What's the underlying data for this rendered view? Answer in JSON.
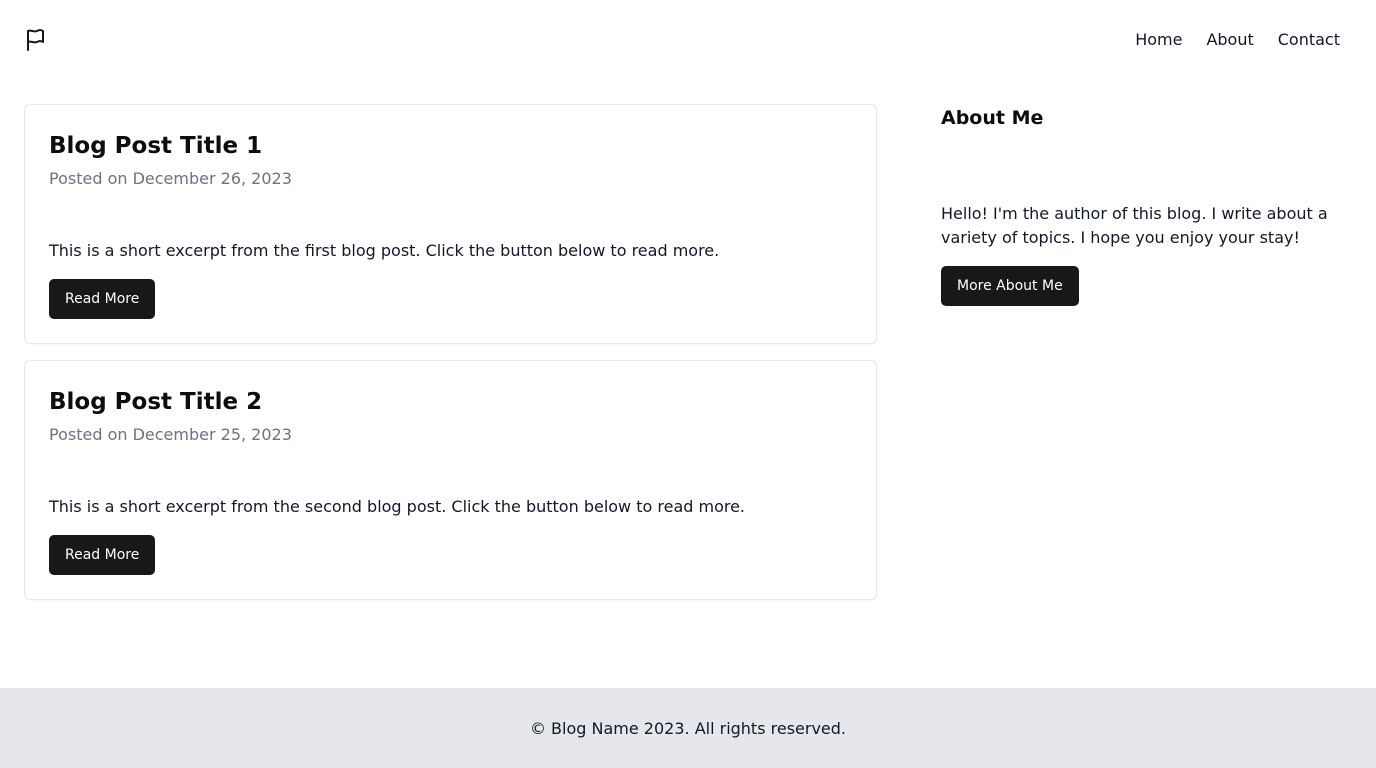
{
  "header": {
    "logo_icon": "flag-icon",
    "nav": [
      {
        "label": "Home"
      },
      {
        "label": "About"
      },
      {
        "label": "Contact"
      }
    ]
  },
  "posts": [
    {
      "title": "Blog Post Title 1",
      "date": "Posted on December 26, 2023",
      "excerpt": "This is a short excerpt from the first blog post. Click the button below to read more.",
      "button": "Read More"
    },
    {
      "title": "Blog Post Title 2",
      "date": "Posted on December 25, 2023",
      "excerpt": "This is a short excerpt from the second blog post. Click the button below to read more.",
      "button": "Read More"
    }
  ],
  "sidebar": {
    "title": "About Me",
    "text": "Hello! I'm the author of this blog. I write about a variety of topics. I hope you enjoy your stay!",
    "button": "More About Me"
  },
  "footer": {
    "text": "© Blog Name 2023. All rights reserved."
  },
  "colors": {
    "button_bg": "#18181b",
    "footer_bg": "#e5e7eb",
    "muted_text": "#6b7280"
  }
}
